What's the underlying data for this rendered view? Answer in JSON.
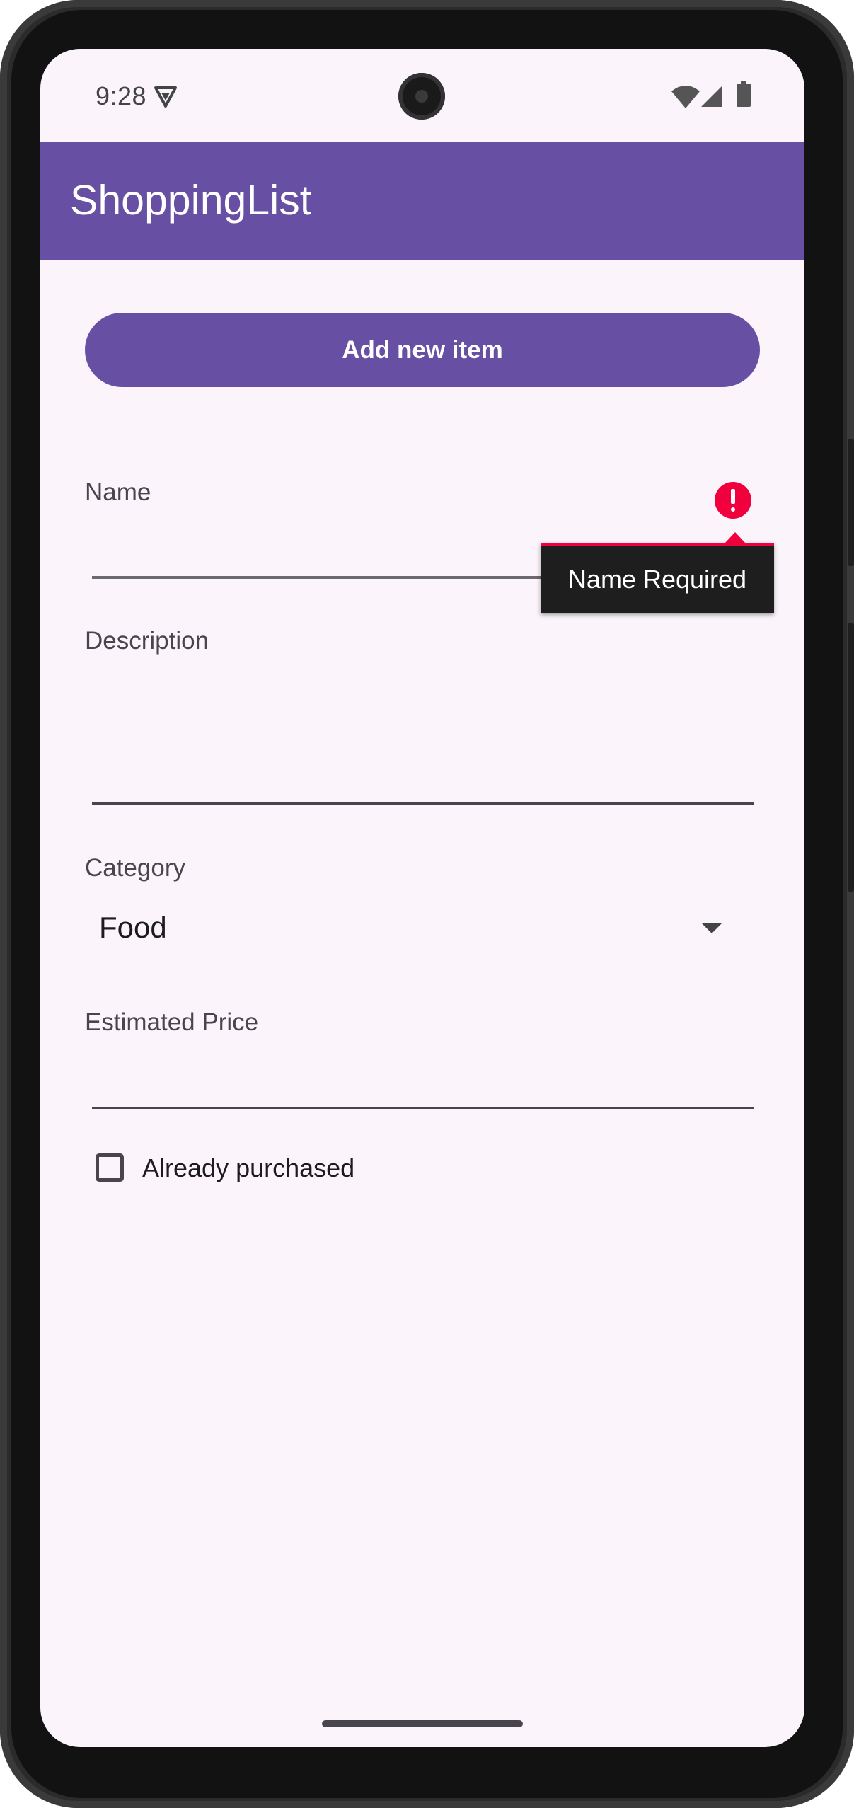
{
  "status_bar": {
    "time": "9:28",
    "icons": [
      "vpn-key-icon",
      "wifi-icon",
      "signal-icon",
      "battery-icon"
    ]
  },
  "app_bar": {
    "title": "ShoppingList",
    "color": "#6750a4"
  },
  "form": {
    "add_button_label": "Add new item",
    "name": {
      "label": "Name",
      "value": "",
      "error": "Name Required"
    },
    "description": {
      "label": "Description",
      "value": ""
    },
    "category": {
      "label": "Category",
      "selected": "Food"
    },
    "price": {
      "label": "Estimated Price",
      "value": ""
    },
    "purchased": {
      "label": "Already purchased",
      "checked": false
    }
  },
  "colors": {
    "accent": "#6750a4",
    "error": "#f0003c",
    "background": "#fcf4fb"
  }
}
